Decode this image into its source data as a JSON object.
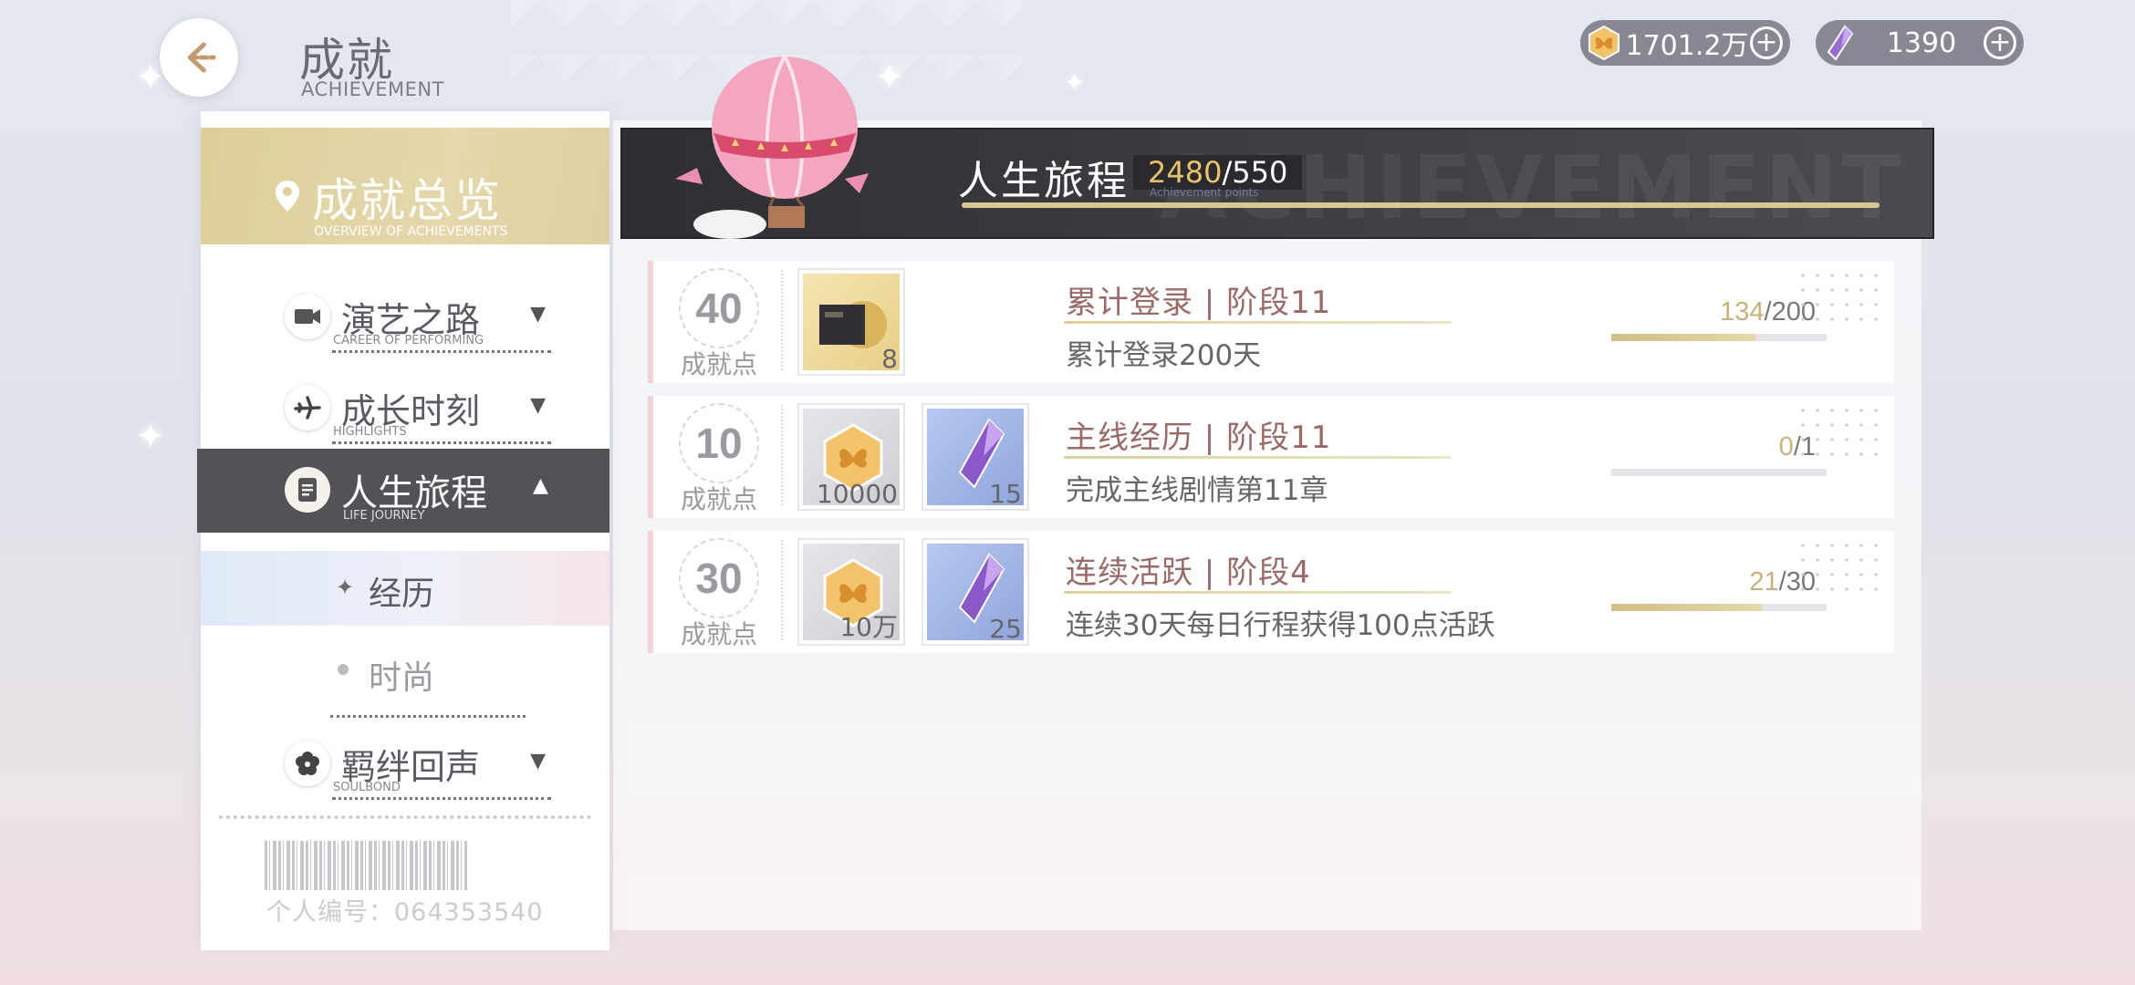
{
  "header": {
    "title": "成就",
    "subtitle": "ACHIEVEMENT"
  },
  "currency": {
    "gold": {
      "icon": "butterfly-coin-icon",
      "value": "1701.2万"
    },
    "gem": {
      "icon": "purple-crystal-icon",
      "value": "1390"
    }
  },
  "sidebar": {
    "overview_title": "成就总览",
    "overview_subtitle": "OVERVIEW OF ACHIEVEMENTS",
    "categories": [
      {
        "label": "演艺之路",
        "sub": "CAREER OF PERFORMING",
        "icon": "camera-icon"
      },
      {
        "label": "成长时刻",
        "sub": "HIGHLIGHTS",
        "icon": "plane-icon"
      },
      {
        "label": "人生旅程",
        "sub": "LIFE JOURNEY",
        "icon": "document-icon"
      },
      {
        "label": "羁绊回声",
        "sub": "SOULBOND",
        "icon": "flower-icon"
      }
    ],
    "subitems": [
      {
        "label": "经历"
      },
      {
        "label": "时尚"
      }
    ],
    "personal_id": "个人编号：064353540"
  },
  "banner": {
    "title": "人生旅程",
    "points_current": "2480",
    "points_total": "/550",
    "points_label": "Achievement points"
  },
  "achievements": [
    {
      "points": "40",
      "points_label": "成就点",
      "rewards": [
        {
          "icon": "record-album-icon",
          "qty": "8"
        }
      ],
      "title": "累计登录 | 阶段11",
      "desc": "累计登录200天",
      "progress_current": "134",
      "progress_total": "/200",
      "progress_fraction": 0.67
    },
    {
      "points": "10",
      "points_label": "成就点",
      "rewards": [
        {
          "icon": "butterfly-coin-icon",
          "qty": "10000"
        },
        {
          "icon": "purple-crystal-icon",
          "qty": "15"
        }
      ],
      "title": "主线经历 | 阶段11",
      "desc": "完成主线剧情第11章",
      "progress_current": "0",
      "progress_total": "/1",
      "progress_fraction": 0.0
    },
    {
      "points": "30",
      "points_label": "成就点",
      "rewards": [
        {
          "icon": "butterfly-coin-icon",
          "qty": "10万"
        },
        {
          "icon": "purple-crystal-icon",
          "qty": "25"
        }
      ],
      "title": "连续活跃 | 阶段4",
      "desc": "连续30天每日行程获得100点活跃",
      "progress_current": "21",
      "progress_total": "/30",
      "progress_fraction": 0.7
    }
  ],
  "colors": {
    "gold_accent": "#e8c36a",
    "active_nav": "#535257",
    "title_rose": "#9a6a66"
  }
}
